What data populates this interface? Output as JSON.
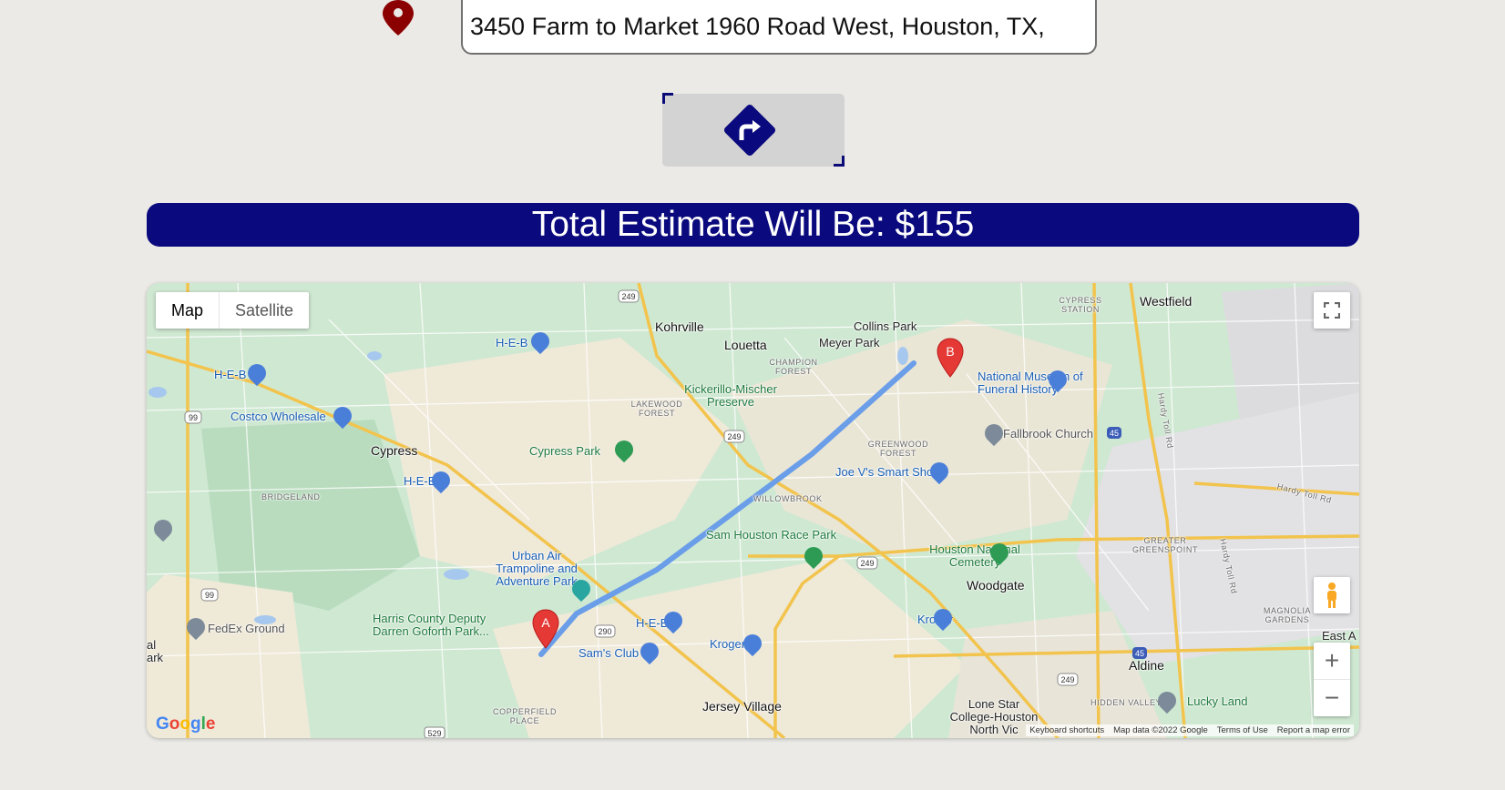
{
  "address": {
    "value": "3450 Farm to Market 1960 Road West, Houston, TX,",
    "icon": "map-marker-icon",
    "icon_color": "#8b0000"
  },
  "route_button": {
    "icon": "turn-right-sign-icon",
    "icon_color": "#0a0a7e"
  },
  "estimate": {
    "text": "Total Estimate Will Be: $155",
    "color": "#0a0a7e"
  },
  "map": {
    "type_map": "Map",
    "type_satellite": "Satellite",
    "markers": {
      "start": "A",
      "end": "B"
    },
    "labels": {
      "westfield": "Westfield",
      "cypress_station": "CYPRESS STATION",
      "collins_park": "Collins Park",
      "meyer_park": "Meyer Park",
      "kohrville": "Kohrville",
      "louetta": "Louetta",
      "champion_forest": "CHAMPION FOREST",
      "kickerillo": "Kickerillo-Mischer Preserve",
      "lakewood_forest": "LAKEWOOD FOREST",
      "heb_1": "H-E-B",
      "heb_2": "H-E-B",
      "heb_3": "H-E-B",
      "heb_4": "H-E-B",
      "costco": "Costco Wholesale",
      "cypress": "Cypress",
      "cypress_park": "Cypress Park",
      "bridgeland": "BRIDGELAND",
      "greenwood_forest": "GREENWOOD FOREST",
      "joe_vs": "Joe V's Smart Shop",
      "willowbrook": "WILLOWBROOK",
      "sam_houston_race_park": "Sam Houston Race Park",
      "national_museum": "National Museum of Funeral History",
      "fallbrook_church": "Fallbrook Church",
      "hardy_toll_rd_1": "Hardy Toll Rd",
      "hardy_toll_rd_2": "Hardy Toll Rd",
      "hardy_toll_rd_3": "Hardy Toll Rd",
      "greater_greenspoint": "GREATER GREENSPOINT",
      "houston_national_cemetery": "Houston National Cemetery",
      "woodgate": "Woodgate",
      "urban_air": "Urban Air Trampoline and Adventure Park",
      "harris_county_park": "Harris County Deputy Darren Goforth Park...",
      "fedex_ground": "FedEx Ground",
      "sams_club": "Sam's Club",
      "kroger_1": "Kroger",
      "kroger_2": "Kroger",
      "magnolia_gardens": "MAGNOLIA GARDENS",
      "east_a": "East A",
      "aldine": "Aldine",
      "jersey_village": "Jersey Village",
      "copperfield_place": "COPPERFIELD PLACE",
      "hidden_valley": "HIDDEN VALLEY",
      "lucky_land": "Lucky Land",
      "lone_star": "Lone Star College-Houston North Vic",
      "edge_al": "al",
      "edge_ark": "ark"
    },
    "shields": {
      "s249_1": "249",
      "s249_2": "249",
      "s249_3": "249",
      "s249_4": "249",
      "s99_1": "99",
      "s99_2": "99",
      "s290": "290",
      "s45_1": "45",
      "s45_2": "45",
      "s529": "529"
    },
    "footer": {
      "keyboard": "Keyboard shortcuts",
      "data": "Map data ©2022 Google",
      "terms": "Terms of Use",
      "report": "Report a map error"
    },
    "logo": "Google",
    "zoom_in": "+",
    "zoom_out": "−",
    "route_color": "#6b9ee8"
  }
}
